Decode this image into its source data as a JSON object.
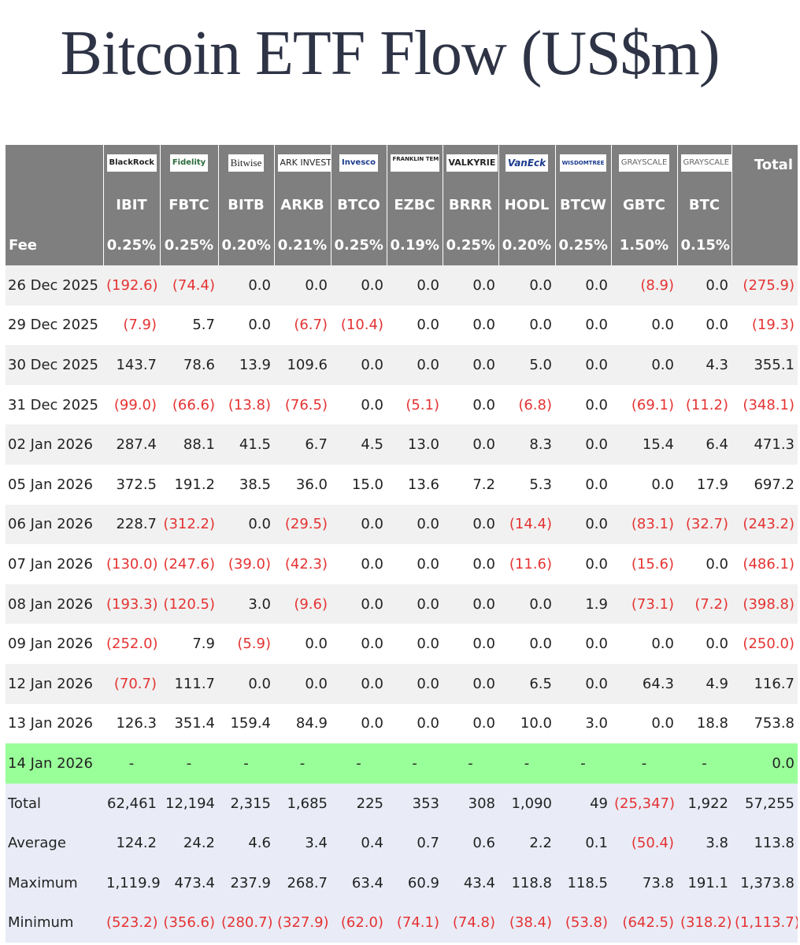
{
  "title": "Bitcoin ETF Flow (US$m)",
  "header": {
    "issuers": [
      {
        "name": "BlackRock",
        "icon": "blackrock-logo"
      },
      {
        "name": "Fidelity",
        "icon": "fidelity-logo"
      },
      {
        "name": "Bitwise",
        "icon": "bitwise-logo"
      },
      {
        "name": "ARK INVEST",
        "icon": "ark-invest-logo"
      },
      {
        "name": "Invesco",
        "icon": "invesco-logo"
      },
      {
        "name": "FRANKLIN TEMPLETON",
        "icon": "franklin-templeton-logo"
      },
      {
        "name": "VALKYRIE",
        "icon": "valkyrie-logo"
      },
      {
        "name": "VanEck",
        "icon": "vaneck-logo"
      },
      {
        "name": "WISDOMTREE",
        "icon": "wisdomtree-logo"
      },
      {
        "name": "GRAYSCALE",
        "icon": "grayscale-logo"
      },
      {
        "name": "GRAYSCALE",
        "icon": "grayscale-logo"
      }
    ],
    "total_label": "Total",
    "fee_label": "Fee"
  },
  "chart_data": {
    "type": "table",
    "title": "Bitcoin ETF Flow (US$m)",
    "tickers": [
      "IBIT",
      "FBTC",
      "BITB",
      "ARKB",
      "BTCO",
      "EZBC",
      "BRRR",
      "HODL",
      "BTCW",
      "GBTC",
      "BTC"
    ],
    "fees": [
      "0.25%",
      "0.25%",
      "0.20%",
      "0.21%",
      "0.25%",
      "0.19%",
      "0.25%",
      "0.20%",
      "0.25%",
      "1.50%",
      "0.15%"
    ],
    "rows": [
      {
        "date": "26 Dec 2025",
        "values": [
          "(192.6)",
          "(74.4)",
          "0.0",
          "0.0",
          "0.0",
          "0.0",
          "0.0",
          "0.0",
          "0.0",
          "(8.9)",
          "0.0"
        ],
        "total": "(275.9)"
      },
      {
        "date": "29 Dec 2025",
        "values": [
          "(7.9)",
          "5.7",
          "0.0",
          "(6.7)",
          "(10.4)",
          "0.0",
          "0.0",
          "0.0",
          "0.0",
          "0.0",
          "0.0"
        ],
        "total": "(19.3)"
      },
      {
        "date": "30 Dec 2025",
        "values": [
          "143.7",
          "78.6",
          "13.9",
          "109.6",
          "0.0",
          "0.0",
          "0.0",
          "5.0",
          "0.0",
          "0.0",
          "4.3"
        ],
        "total": "355.1"
      },
      {
        "date": "31 Dec 2025",
        "values": [
          "(99.0)",
          "(66.6)",
          "(13.8)",
          "(76.5)",
          "0.0",
          "(5.1)",
          "0.0",
          "(6.8)",
          "0.0",
          "(69.1)",
          "(11.2)"
        ],
        "total": "(348.1)"
      },
      {
        "date": "02 Jan 2026",
        "values": [
          "287.4",
          "88.1",
          "41.5",
          "6.7",
          "4.5",
          "13.0",
          "0.0",
          "8.3",
          "0.0",
          "15.4",
          "6.4"
        ],
        "total": "471.3"
      },
      {
        "date": "05 Jan 2026",
        "values": [
          "372.5",
          "191.2",
          "38.5",
          "36.0",
          "15.0",
          "13.6",
          "7.2",
          "5.3",
          "0.0",
          "0.0",
          "17.9"
        ],
        "total": "697.2"
      },
      {
        "date": "06 Jan 2026",
        "values": [
          "228.7",
          "(312.2)",
          "0.0",
          "(29.5)",
          "0.0",
          "0.0",
          "0.0",
          "(14.4)",
          "0.0",
          "(83.1)",
          "(32.7)"
        ],
        "total": "(243.2)"
      },
      {
        "date": "07 Jan 2026",
        "values": [
          "(130.0)",
          "(247.6)",
          "(39.0)",
          "(42.3)",
          "0.0",
          "0.0",
          "0.0",
          "(11.6)",
          "0.0",
          "(15.6)",
          "0.0"
        ],
        "total": "(486.1)"
      },
      {
        "date": "08 Jan 2026",
        "values": [
          "(193.3)",
          "(120.5)",
          "3.0",
          "(9.6)",
          "0.0",
          "0.0",
          "0.0",
          "0.0",
          "1.9",
          "(73.1)",
          "(7.2)"
        ],
        "total": "(398.8)"
      },
      {
        "date": "09 Jan 2026",
        "values": [
          "(252.0)",
          "7.9",
          "(5.9)",
          "0.0",
          "0.0",
          "0.0",
          "0.0",
          "0.0",
          "0.0",
          "0.0",
          "0.0"
        ],
        "total": "(250.0)"
      },
      {
        "date": "12 Jan 2026",
        "values": [
          "(70.7)",
          "111.7",
          "0.0",
          "0.0",
          "0.0",
          "0.0",
          "0.0",
          "6.5",
          "0.0",
          "64.3",
          "4.9"
        ],
        "total": "116.7"
      },
      {
        "date": "13 Jan 2026",
        "values": [
          "126.3",
          "351.4",
          "159.4",
          "84.9",
          "0.0",
          "0.0",
          "0.0",
          "10.0",
          "3.0",
          "0.0",
          "18.8"
        ],
        "total": "753.8"
      },
      {
        "date": "14 Jan 2026",
        "values": [
          "-",
          "-",
          "-",
          "-",
          "-",
          "-",
          "-",
          "-",
          "-",
          "-",
          "-"
        ],
        "total": "0.0",
        "highlight": true
      }
    ],
    "summary": [
      {
        "label": "Total",
        "values": [
          "62,461",
          "12,194",
          "2,315",
          "1,685",
          "225",
          "353",
          "308",
          "1,090",
          "49",
          "(25,347)",
          "1,922"
        ],
        "total": "57,255"
      },
      {
        "label": "Average",
        "values": [
          "124.2",
          "24.2",
          "4.6",
          "3.4",
          "0.4",
          "0.7",
          "0.6",
          "2.2",
          "0.1",
          "(50.4)",
          "3.8"
        ],
        "total": "113.8"
      },
      {
        "label": "Maximum",
        "values": [
          "1,119.9",
          "473.4",
          "237.9",
          "268.7",
          "63.4",
          "60.9",
          "43.4",
          "118.8",
          "118.5",
          "73.8",
          "191.1"
        ],
        "total": "1,373.8"
      },
      {
        "label": "Minimum",
        "values": [
          "(523.2)",
          "(356.6)",
          "(280.7)",
          "(327.9)",
          "(62.0)",
          "(74.1)",
          "(74.8)",
          "(38.4)",
          "(53.8)",
          "(642.5)",
          "(318.2)"
        ],
        "total": "(1,113.7)"
      }
    ]
  },
  "colors": {
    "header_bg": "#7f7f7f",
    "negative": "#e53333",
    "highlight": "#99ff99",
    "summary_bg": "#e9ecf7",
    "row_alt": "#f1f1f1"
  }
}
